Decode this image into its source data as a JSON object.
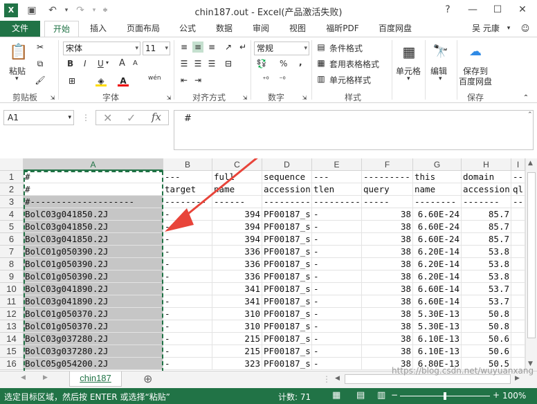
{
  "window": {
    "title": "chin187.out - Excel(产品激活失败)",
    "controls": [
      "?",
      "—",
      "☐",
      "✕"
    ]
  },
  "ribbon_tabs": [
    {
      "label": "文件",
      "active": false
    },
    {
      "label": "开始",
      "active": true
    },
    {
      "label": "插入",
      "active": false
    },
    {
      "label": "页面布局",
      "active": false
    },
    {
      "label": "公式",
      "active": false
    },
    {
      "label": "数据",
      "active": false
    },
    {
      "label": "审阅",
      "active": false
    },
    {
      "label": "视图",
      "active": false
    },
    {
      "label": "福昕PDF",
      "active": false
    },
    {
      "label": "百度网盘",
      "active": false
    }
  ],
  "user": {
    "name": "吴 元康"
  },
  "ribbon": {
    "clipboard": {
      "paste": "粘贴",
      "label": "剪贴板"
    },
    "font": {
      "name": "宋体",
      "size": "11",
      "label": "字体",
      "bold": "B",
      "italic": "I",
      "underline": "U",
      "grow": "A",
      "shrink": "A",
      "wen": "wén"
    },
    "alignment": {
      "label": "对齐方式"
    },
    "number": {
      "format": "常规",
      "label": "数字",
      "percent": "%",
      "comma": ","
    },
    "styles": {
      "conditional": "条件格式",
      "table": "套用表格格式",
      "cell": "单元格样式",
      "label": "样式"
    },
    "cells": {
      "label": "单元格"
    },
    "editing": {
      "label": "编辑"
    },
    "save": {
      "line1": "保存到",
      "line2": "百度网盘",
      "label": "保存"
    }
  },
  "formula_bar": {
    "name_box": "A1",
    "fx": "fx",
    "formula": "#"
  },
  "columns": [
    "A",
    "B",
    "C",
    "D",
    "E",
    "F",
    "G",
    "H",
    "I"
  ],
  "rows": [
    {
      "num": "1",
      "cells": [
        "#",
        "---",
        "full",
        "sequence",
        "---",
        "---------",
        "this",
        "domain",
        "--"
      ]
    },
    {
      "num": "2",
      "cells": [
        "#",
        "target",
        "name",
        "accession",
        "tlen",
        "query",
        "name",
        "accession",
        "ql"
      ]
    },
    {
      "num": "3",
      "cells": [
        "#--------------------",
        "--------",
        "------",
        "---------",
        "---------",
        "-----",
        "--------",
        "-------",
        "--"
      ]
    },
    {
      "num": "4",
      "cells": [
        "BolC03g041850.2J",
        "-",
        "394",
        "PF00187_s",
        "-",
        "38",
        "6.60E-24",
        "85.7",
        ""
      ]
    },
    {
      "num": "5",
      "cells": [
        "BolC03g041850.2J",
        "-",
        "394",
        "PF00187_s",
        "-",
        "38",
        "6.60E-24",
        "85.7",
        ""
      ]
    },
    {
      "num": "6",
      "cells": [
        "BolC03g041850.2J",
        "-",
        "394",
        "PF00187_s",
        "-",
        "38",
        "6.60E-24",
        "85.7",
        ""
      ]
    },
    {
      "num": "7",
      "cells": [
        "BolC01g050390.2J",
        "-",
        "336",
        "PF00187_s",
        "-",
        "38",
        "6.20E-14",
        "53.8",
        ""
      ]
    },
    {
      "num": "8",
      "cells": [
        "BolC01g050390.2J",
        "-",
        "336",
        "PF00187_s",
        "-",
        "38",
        "6.20E-14",
        "53.8",
        ""
      ]
    },
    {
      "num": "9",
      "cells": [
        "BolC01g050390.2J",
        "-",
        "336",
        "PF00187_s",
        "-",
        "38",
        "6.20E-14",
        "53.8",
        ""
      ]
    },
    {
      "num": "10",
      "cells": [
        "BolC03g041890.2J",
        "-",
        "341",
        "PF00187_s",
        "-",
        "38",
        "6.60E-14",
        "53.7",
        ""
      ]
    },
    {
      "num": "11",
      "cells": [
        "BolC03g041890.2J",
        "-",
        "341",
        "PF00187_s",
        "-",
        "38",
        "6.60E-14",
        "53.7",
        ""
      ]
    },
    {
      "num": "12",
      "cells": [
        "BolC01g050370.2J",
        "-",
        "310",
        "PF00187_s",
        "-",
        "38",
        "5.30E-13",
        "50.8",
        ""
      ]
    },
    {
      "num": "13",
      "cells": [
        "BolC01g050370.2J",
        "-",
        "310",
        "PF00187_s",
        "-",
        "38",
        "5.30E-13",
        "50.8",
        ""
      ]
    },
    {
      "num": "14",
      "cells": [
        "BolC03g037280.2J",
        "-",
        "215",
        "PF00187_s",
        "-",
        "38",
        "6.10E-13",
        "50.6",
        ""
      ]
    },
    {
      "num": "15",
      "cells": [
        "BolC03g037280.2J",
        "-",
        "215",
        "PF00187_s",
        "-",
        "38",
        "6.10E-13",
        "50.6",
        ""
      ]
    },
    {
      "num": "16",
      "cells": [
        "BolC05g054200.2J",
        "-",
        "323",
        "PF00187_s",
        "-",
        "38",
        "6.80E-13",
        "50.5",
        ""
      ]
    }
  ],
  "sheet": {
    "tab": "chin187",
    "add": "⊕"
  },
  "status": {
    "message": "选定目标区域，然后按 ENTER 或选择“粘贴”",
    "count": "计数: 71",
    "zoom": "100%"
  },
  "watermark": "https://blog.csdn.net/wuyuanxang",
  "colors": {
    "accent": "#217346",
    "arrow": "#e8443a",
    "selection": "#c6c6c6"
  }
}
